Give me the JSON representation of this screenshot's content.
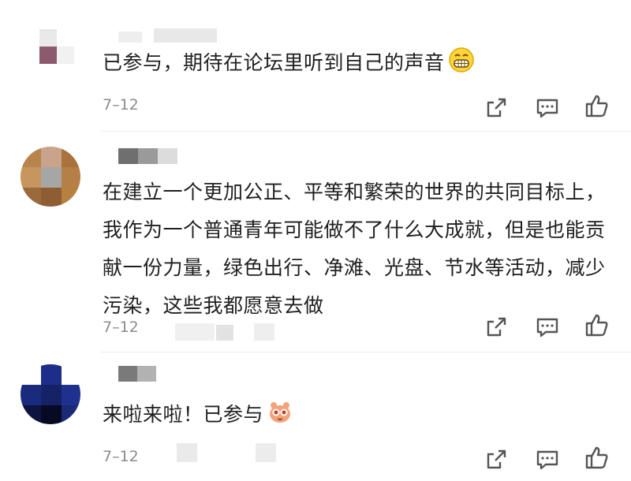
{
  "comments": [
    {
      "text": "已参与，期待在论坛里听到自己的声音",
      "date": "7–12",
      "emoji": "grin-emoji"
    },
    {
      "text": "在建立一个更加公正、平等和繁荣的世界的共同目标上，我作为一个普通青年可能做不了什么大成就，但是也能贡献一份力量，绿色出行、净滩、光盘、节水等活动，减少污染，这些我都愿意去做",
      "date": "7–12"
    },
    {
      "text": "来啦来啦！已参与",
      "date": "7–12",
      "emoji": "cute-creature-emoji"
    }
  ],
  "icons": {
    "share": "share-icon",
    "reply": "reply-icon",
    "like": "thumbs-up-icon"
  },
  "colors": {
    "date": "#8c8c8c",
    "icon": "#555555",
    "text": "#1f1f1f"
  }
}
